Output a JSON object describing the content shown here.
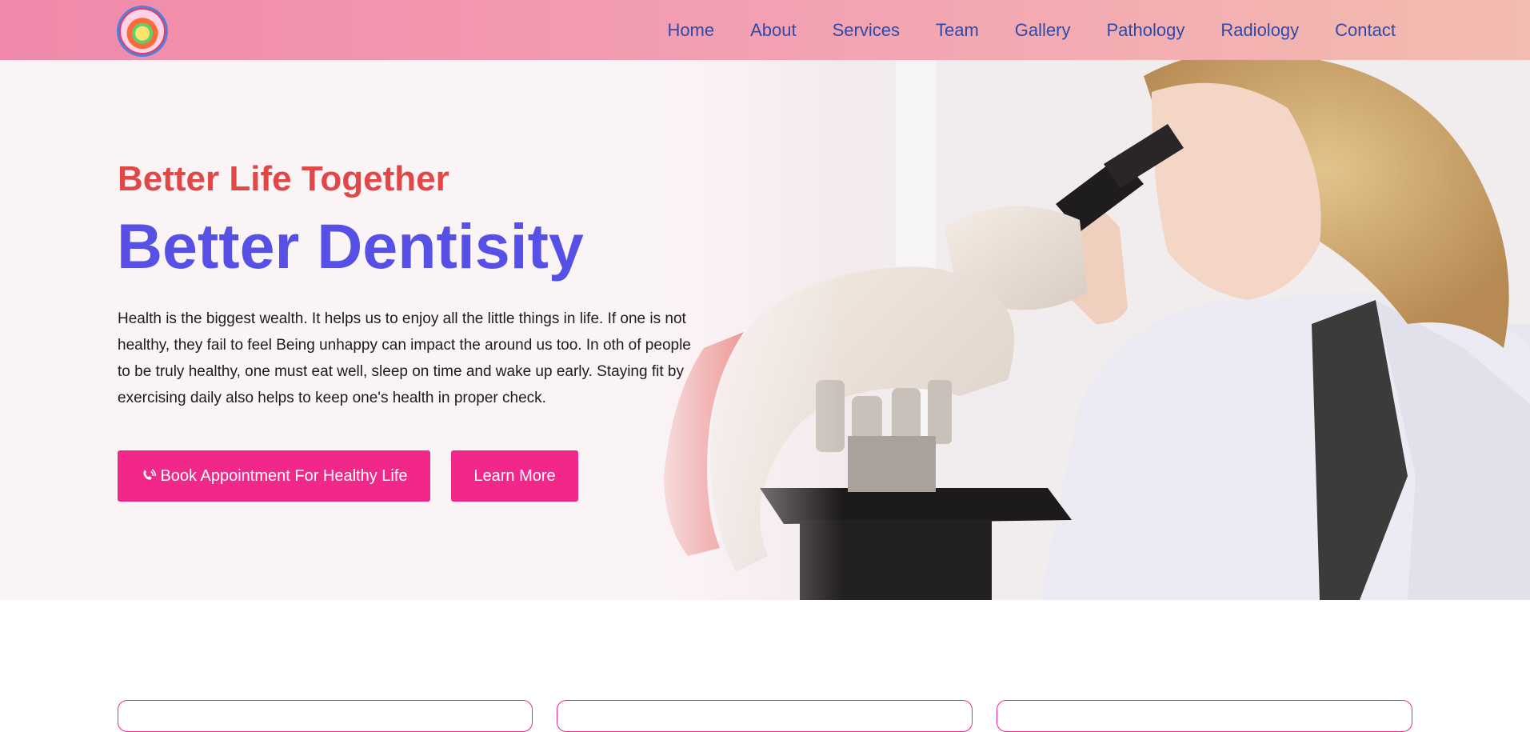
{
  "header": {
    "logo_alt": "Diagnostic Centre logo",
    "nav": [
      "Home",
      "About",
      "Services",
      "Team",
      "Gallery",
      "Pathology",
      "Radiology",
      "Contact"
    ]
  },
  "hero": {
    "subtitle": "Better Life Together",
    "title": "Better Dentisity",
    "paragraph": "Health is the biggest wealth. It helps us to enjoy all the little things in life. If one is not healthy, they fail to feel Being unhappy can impact the around us too. In oth of people to be truly healthy, one must eat well, sleep on time and wake up early. Staying fit by exercising daily also helps to keep one's health in proper check.",
    "book_button": "Book Appointment For Healthy Life",
    "learn_button": "Learn More",
    "book_icon": "phone-volume-icon"
  },
  "colors": {
    "accent": "#f2278a",
    "title": "#5650e6",
    "subtitle": "#e24748",
    "nav_text": "#2f4aa8"
  }
}
